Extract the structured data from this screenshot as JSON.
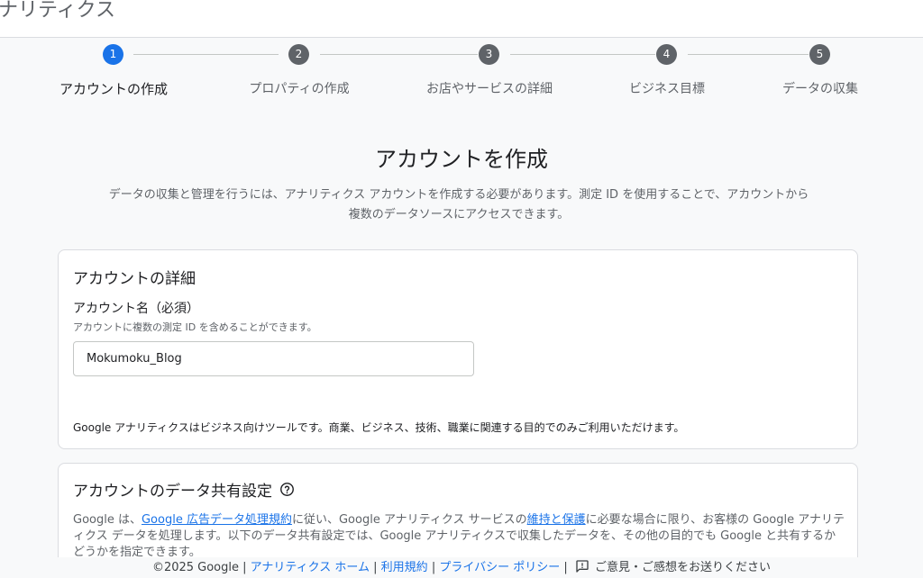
{
  "header": {
    "app_title": "ナリティクス"
  },
  "stepper": {
    "steps": [
      {
        "number": "1",
        "label": "アカウントの作成",
        "active": true
      },
      {
        "number": "2",
        "label": "プロパティの作成",
        "active": false
      },
      {
        "number": "3",
        "label": "お店やサービスの詳細",
        "active": false
      },
      {
        "number": "4",
        "label": "ビジネス目標",
        "active": false
      },
      {
        "number": "5",
        "label": "データの収集",
        "active": false
      }
    ]
  },
  "main": {
    "heading": "アカウントを作成",
    "description": "データの収集と管理を行うには、アナリティクス アカウントを作成する必要があります。測定 ID を使用することで、アカウントから複数のデータソースにアクセスできます。"
  },
  "account_details": {
    "title": "アカウントの詳細",
    "name_label": "アカウント名（必須）",
    "name_hint": "アカウントに複数の測定 ID を含めることができます。",
    "name_value": "Mokumoku_Blog",
    "notice": "Google アナリティクスはビジネス向けツールです。商業、ビジネス、技術、職業に関連する目的でのみご利用いただけます。"
  },
  "data_sharing": {
    "title": "アカウントのデータ共有設定",
    "help_icon": "help-circle-icon",
    "text_1": "Google は、",
    "link_1": "Google 広告データ処理規約",
    "text_2": "に従い、Google アナリティクス サービスの",
    "link_2": "維持と保護",
    "text_3": "に必要な場合に限り、お客様の Google アナリティクス データを処理します。以下のデータ共有設定では、Google アナリティクスで収集したデータを、その他の目的でも Google と共有するかどうかを指定できます。"
  },
  "footer": {
    "copyright": "©2025 Google",
    "sep": "|",
    "link_home": "アナリティクス ホーム",
    "link_terms": "利用規約",
    "link_privacy": "プライバシー ポリシー",
    "feedback": "ご意見・ご感想をお送りください",
    "feedback_icon": "feedback-icon"
  },
  "colors": {
    "accent": "#1a73e8",
    "inactive_step": "#5f6368",
    "background": "#f8f9fa"
  }
}
